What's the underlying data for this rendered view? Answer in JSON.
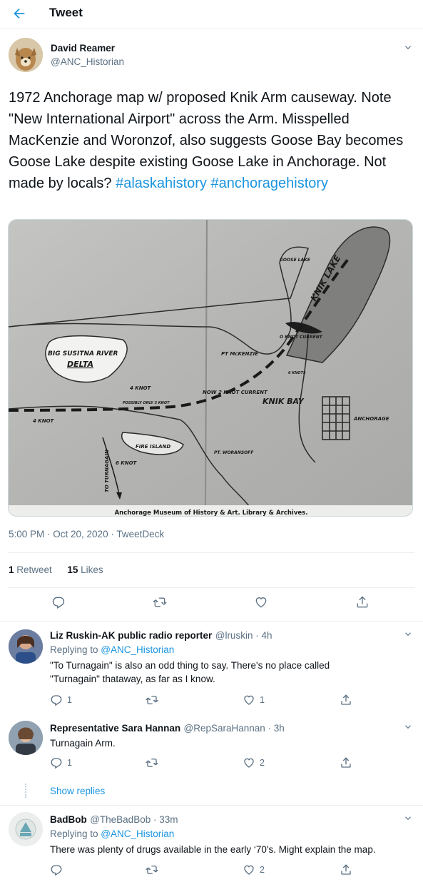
{
  "header": {
    "title": "Tweet"
  },
  "tweet": {
    "author_name": "David Reamer",
    "author_handle": "@ANC_Historian",
    "text_plain_1": "1972 Anchorage map w/ proposed Knik Arm causeway. Note \"New International Airport\" across the Arm. Misspelled MacKenzie and Woronzof, also suggests Goose Bay becomes Goose Lake despite existing Goose Lake in Anchorage. Not made by locals? ",
    "hashtag_1": "#alaskahistory",
    "hashtag_2": "#anchoragehistory",
    "timestamp": "5:00 PM · Oct 20, 2020 · TweetDeck",
    "retweets_count": "1",
    "retweets_label": "Retweet",
    "likes_count": "15",
    "likes_label": "Likes"
  },
  "map": {
    "caption": "Anchorage Museum of History & Art.  Library & Archives.",
    "labels": {
      "big_susitna": "BIG SUSITNA RIVER",
      "delta": "DELTA",
      "goose_lake": "GOOSE LAKE",
      "knik_lake": "KNIK LAKE",
      "o_knot": "O KNOT CURRENT",
      "mckenzie": "PT McKENZIE",
      "knik_bay": "KNIK BAY",
      "anchorage": "ANCHORAGE",
      "four_knot_a": "4 KNOT",
      "four_knot_b": "POSSIBLY ONLY 3 KNOT",
      "now_2_knot": "NOW 2 KNOT CURRENT",
      "six_knots": "6 KNOTS",
      "four_knot_left": "4 KNOT",
      "fire_island": "FIRE ISLAND",
      "six_knot": "6 KNOT",
      "to_turnagain": "TO TURNAGAIN",
      "pt_woransoff": "PT. WORANSOFF"
    }
  },
  "replies": [
    {
      "name": "Liz Ruskin-AK public radio reporter",
      "handle_time": "@lruskin · 4h",
      "replying_to_label": "Replying to ",
      "replying_to": "@ANC_Historian",
      "text": "\"To Turnagain\" is also an odd thing to say. There's no place called \"Turnagain\" thataway, as far as I know.",
      "reply_count": "1",
      "retweet_count": "",
      "like_count": "1"
    },
    {
      "name": "Representative Sara Hannan",
      "handle_time": "@RepSaraHannan · 3h",
      "text": "Turnagain Arm.",
      "reply_count": "1",
      "retweet_count": "",
      "like_count": "2"
    },
    {
      "name": "BadBob",
      "handle_time": "@TheBadBob · 33m",
      "replying_to_label": "Replying to ",
      "replying_to": "@ANC_Historian",
      "text": "There was plenty of drugs available in the early ‘70's. Might explain the map.",
      "reply_count": "",
      "retweet_count": "",
      "like_count": "2"
    }
  ],
  "show_replies": "Show replies",
  "colors": {
    "accent": "#1b95e0",
    "secondary_text": "#5b7083",
    "border": "#ebeef0"
  }
}
